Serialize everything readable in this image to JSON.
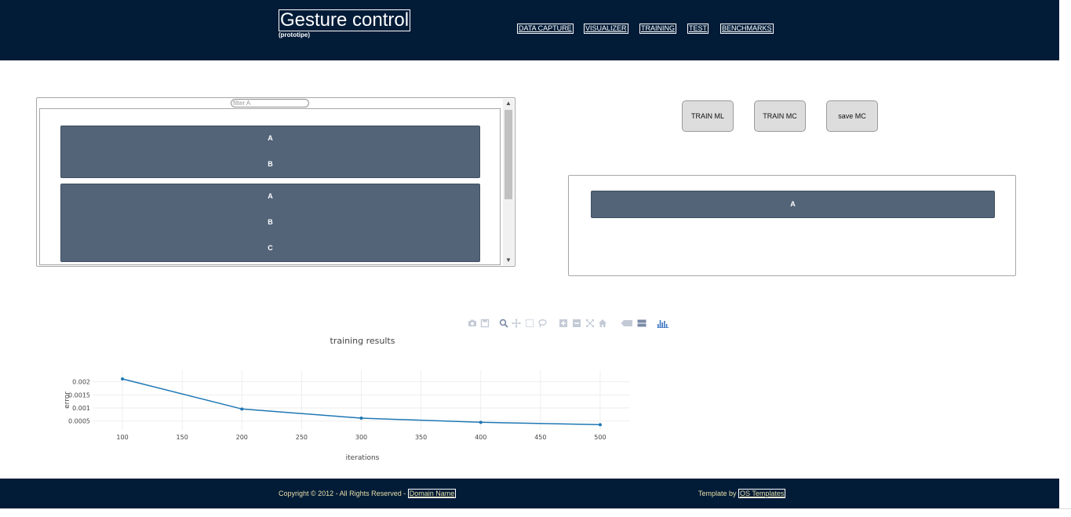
{
  "header": {
    "title": "Gesture control",
    "subtitle": "(prototipe)",
    "nav": [
      "DATA CAPTURE",
      "VISUALIZER",
      "TRAINING",
      "TEST",
      "BENCHMARKS"
    ]
  },
  "left_panel": {
    "filter_placeholder": "filter A",
    "groups": [
      {
        "items": [
          "A",
          "B"
        ]
      },
      {
        "items": [
          "A",
          "B",
          "C"
        ]
      }
    ]
  },
  "buttons": {
    "train_ml": "TRAIN ML",
    "train_mc": "TRAIN MC",
    "save_mc": "save MC"
  },
  "right_panel": {
    "result_item": "A"
  },
  "modebar": {
    "icons": [
      "camera-icon",
      "save-icon",
      "zoom-icon",
      "pan-icon",
      "box-select-icon",
      "lasso-icon",
      "zoom-in-icon",
      "zoom-out-icon",
      "autoscale-icon",
      "reset-axes-icon",
      "spike-lines-icon",
      "compare-hover-icon",
      "plotly-logo-icon"
    ]
  },
  "chart_data": {
    "type": "line",
    "title": "training results",
    "xlabel": "iterations",
    "ylabel": "error",
    "x": [
      100,
      200,
      300,
      400,
      500
    ],
    "series": [
      {
        "values": [
          0.00211,
          0.00096,
          0.00061,
          0.00045,
          0.00036
        ]
      }
    ],
    "xlim": [
      75,
      525
    ],
    "ylim": [
      0.00016,
      0.00244
    ],
    "xticks": [
      100,
      150,
      200,
      250,
      300,
      350,
      400,
      450,
      500
    ],
    "yticks": [
      0.0005,
      0.001,
      0.0015,
      0.002
    ],
    "ytick_labels": [
      "0.0005",
      "0.001",
      "0.0015",
      "0.002"
    ],
    "grid": true,
    "color": "#1f77b4"
  },
  "footer": {
    "copyright": "Copyright © 2012 - All Rights Reserved -",
    "domain_link": "Domain Name",
    "template_by": "Template by",
    "template_link": "OS Templates"
  },
  "colors": {
    "header_bg": "#021c38",
    "card_bg": "#536478",
    "footer_text": "#e8dfa8"
  }
}
